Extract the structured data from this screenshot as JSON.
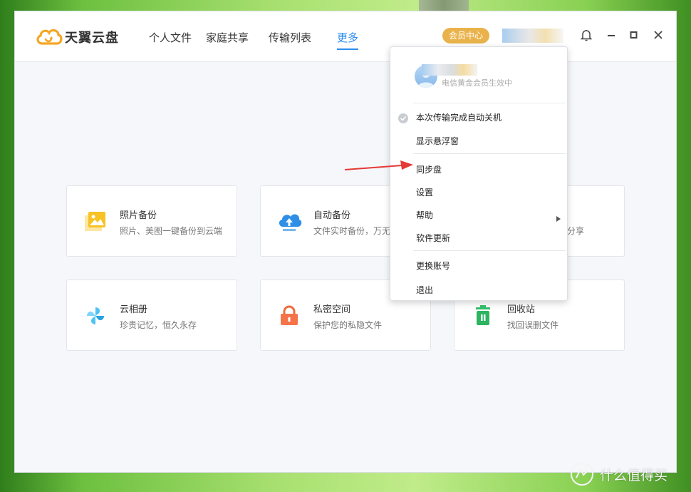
{
  "app": {
    "name": "天翼云盘",
    "brand_color": "#f5a623",
    "accent_color": "#2d8cf0"
  },
  "nav": {
    "items": [
      "个人文件",
      "家庭共享",
      "传输列表",
      "更多"
    ],
    "active_index": 3
  },
  "header": {
    "vip_label": "会员中心"
  },
  "cards": [
    {
      "title": "照片备份",
      "desc": "照片、美图一键备份到云端",
      "icon": "photo-icon"
    },
    {
      "title": "自动备份",
      "desc": "文件实时备份，万无",
      "icon": "cloud-upload-icon"
    },
    {
      "title": "",
      "desc": "分享",
      "icon": ""
    },
    {
      "title": "云相册",
      "desc": "珍贵记忆，恒久永存",
      "icon": "pinwheel-icon"
    },
    {
      "title": "私密空间",
      "desc": "保护您的私隐文件",
      "icon": "lock-icon"
    },
    {
      "title": "回收站",
      "desc": "找回误删文件",
      "icon": "trash-icon"
    }
  ],
  "menu": {
    "status": "电信黄金会员生效中",
    "items": [
      {
        "label": "本次传输完成自动关机",
        "checked": true
      },
      {
        "label": "显示悬浮窗"
      },
      {
        "label": "同步盘"
      },
      {
        "label": "设置"
      },
      {
        "label": "帮助",
        "has_submenu": true
      },
      {
        "label": "软件更新"
      },
      {
        "label": "更换账号"
      },
      {
        "label": "退出"
      }
    ]
  },
  "watermark": {
    "text": "什么值得买",
    "logo_glyph": "值"
  }
}
